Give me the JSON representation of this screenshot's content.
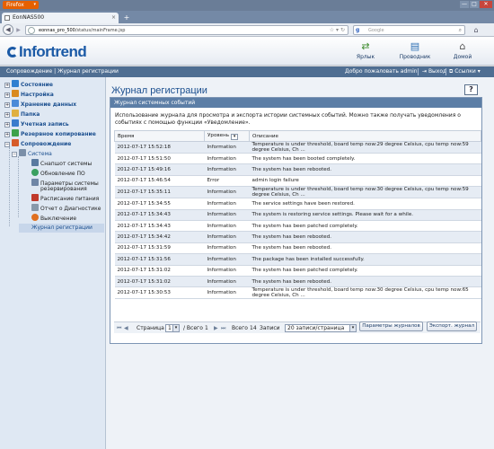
{
  "browser": {
    "app_button": "Firefox",
    "tab_title": "EonNAS500",
    "url_host": "eonnas_pro_500",
    "url_path": "/status/mainFrame.jsp",
    "search_engine": "g",
    "search_placeholder": "Google",
    "window_controls": [
      "—",
      "□",
      "✕"
    ]
  },
  "header": {
    "logo_text": "Infortrend",
    "buttons": [
      {
        "label": "Ярлык",
        "icon": "shortcut-icon"
      },
      {
        "label": "Проводник",
        "icon": "explorer-icon"
      },
      {
        "label": "Домой",
        "icon": "home-icon"
      }
    ]
  },
  "crumbbar": {
    "breadcrumb": "Сопровождение | Журнал регистрации",
    "welcome": "Добро пожаловать admin",
    "logout": "Выход",
    "links": "Ссылки"
  },
  "sidebar": {
    "items": [
      {
        "label": "Состояние",
        "level": 0,
        "color": "#2f7fd0"
      },
      {
        "label": "Настройка",
        "level": 0,
        "color": "#d98a20"
      },
      {
        "label": "Хранение данных",
        "level": 0,
        "color": "#4a8ad8"
      },
      {
        "label": "Папка",
        "level": 0,
        "color": "#e0b040"
      },
      {
        "label": "Учетная запись",
        "level": 0,
        "color": "#3a7ccc"
      },
      {
        "label": "Резервное копирование",
        "level": 0,
        "color": "#3da24a"
      },
      {
        "label": "Сопровождение",
        "level": 0,
        "color": "#d65c2a"
      },
      {
        "label": "Система",
        "level": 1,
        "color": "#7b8fa8"
      },
      {
        "label": "Снапшот системы",
        "level": 2,
        "color": "#5a7aa0"
      },
      {
        "label": "Обновление ПО",
        "level": 2,
        "color": "#3aa060"
      },
      {
        "label": "Параметры системы",
        "level": 2,
        "color": "#6f86a6"
      },
      {
        "label": "резервирования",
        "level": 2,
        "color": ""
      },
      {
        "label": "Расписание питания",
        "level": 2,
        "color": "#c0392b"
      },
      {
        "label": "Отчет о Диагностике",
        "level": 2,
        "color": "#8899aa"
      },
      {
        "label": "Выключение",
        "level": 2,
        "color": "#e07020"
      },
      {
        "label": "Журнал регистрации",
        "level": 1,
        "color": ""
      }
    ]
  },
  "main": {
    "title": "Журнал регистрации",
    "help": "?",
    "panel_title": "Журнал системных событий",
    "description": "Использование журнала для просмотра и экспорта истории системных событий. Можно также получать уведомления о событиях с помощью функции «Уведомление».",
    "columns": [
      "Время",
      "Уровень",
      "Описание"
    ],
    "rows": [
      [
        "2012-07-17  15:52:18",
        "Information",
        "Temperature is under threshold, board temp now:29 degree Celsius, cpu temp now:59 degree Celsius, Ch ..."
      ],
      [
        "2012-07-17  15:51:50",
        "Information",
        "The system has been booted completely."
      ],
      [
        "2012-07-17  15:49:16",
        "Information",
        "The system has been rebooted."
      ],
      [
        "2012-07-17  15:46:54",
        "Error",
        "admin login failure"
      ],
      [
        "2012-07-17  15:35:11",
        "Information",
        "Temperature is under threshold, board temp now:30 degree Celsius, cpu temp now:59 degree Celsius, Ch ..."
      ],
      [
        "2012-07-17  15:34:55",
        "Information",
        "The service settings have been restored."
      ],
      [
        "2012-07-17  15:34:43",
        "Information",
        "The system is restoring service settings. Please wait for a while."
      ],
      [
        "2012-07-17  15:34:43",
        "Information",
        "The system has been patched completely."
      ],
      [
        "2012-07-17  15:34:42",
        "Information",
        "The system has been rebooted."
      ],
      [
        "2012-07-17  15:31:59",
        "Information",
        "The system has been rebooted."
      ],
      [
        "2012-07-17  15:31:56",
        "Information",
        "The package has been installed successfully."
      ],
      [
        "2012-07-17  15:31:02",
        "Information",
        "The system has been patched completely."
      ],
      [
        "2012-07-17  15:31:02",
        "Information",
        "The system has been rebooted."
      ],
      [
        "2012-07-17  15:30:53",
        "Information",
        "Temperature is under threshold, board temp now:30 degree Celsius, cpu temp now:65 degree Celsius, Ch ..."
      ]
    ],
    "pager": {
      "page_label": "Страница",
      "page_value": "1",
      "of_label": "/ Всего",
      "total_pages": "1",
      "total_label": "Всего",
      "total_count": "14",
      "records_label": "Записи",
      "per_page": "20 записи/страница"
    },
    "buttons": {
      "log_params": "Параметры журналов",
      "export": "Экспорт. журнал"
    }
  }
}
